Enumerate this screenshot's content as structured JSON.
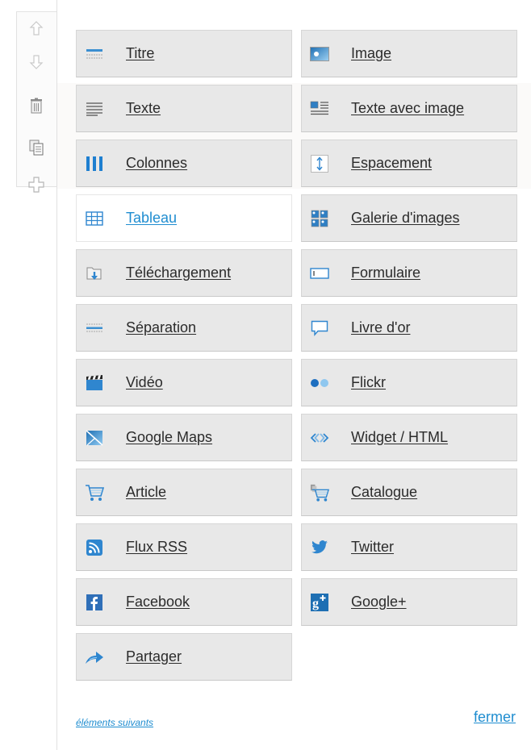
{
  "tools": [
    {
      "name": "move-up-icon"
    },
    {
      "name": "move-down-icon"
    },
    {
      "name": "trash-icon"
    },
    {
      "name": "duplicate-icon"
    },
    {
      "name": "move-icon"
    }
  ],
  "items": [
    {
      "label": "Titre",
      "icon": "title-icon"
    },
    {
      "label": "Image",
      "icon": "image-icon"
    },
    {
      "label": "Texte",
      "icon": "text-icon"
    },
    {
      "label": "Texte avec image",
      "icon": "text-image-icon"
    },
    {
      "label": "Colonnes",
      "icon": "columns-icon"
    },
    {
      "label": "Espacement",
      "icon": "spacing-icon"
    },
    {
      "label": "Tableau",
      "icon": "table-icon"
    },
    {
      "label": "Galerie d'images",
      "icon": "gallery-icon"
    },
    {
      "label": "Téléchargement",
      "icon": "download-icon"
    },
    {
      "label": "Formulaire",
      "icon": "form-icon"
    },
    {
      "label": "Séparation",
      "icon": "separator-icon"
    },
    {
      "label": "Livre d'or",
      "icon": "guestbook-icon"
    },
    {
      "label": "Vidéo",
      "icon": "video-icon"
    },
    {
      "label": "Flickr",
      "icon": "flickr-icon"
    },
    {
      "label": "Google Maps",
      "icon": "google-maps-icon"
    },
    {
      "label": "Widget / HTML",
      "icon": "code-icon"
    },
    {
      "label": "Article",
      "icon": "cart-icon"
    },
    {
      "label": "Catalogue",
      "icon": "catalog-cart-icon"
    },
    {
      "label": "Flux RSS",
      "icon": "rss-icon"
    },
    {
      "label": "Twitter",
      "icon": "twitter-icon"
    },
    {
      "label": "Facebook",
      "icon": "facebook-icon"
    },
    {
      "label": "Google+",
      "icon": "google-plus-icon"
    },
    {
      "label": "Partager",
      "icon": "share-icon"
    }
  ],
  "active_item": "Tableau",
  "footer": {
    "next": "éléments suivants",
    "close": "fermer"
  },
  "colors": {
    "accent": "#1f8dd0",
    "tile": "#e8e8e8",
    "tile_border": "#d6d6d6"
  }
}
